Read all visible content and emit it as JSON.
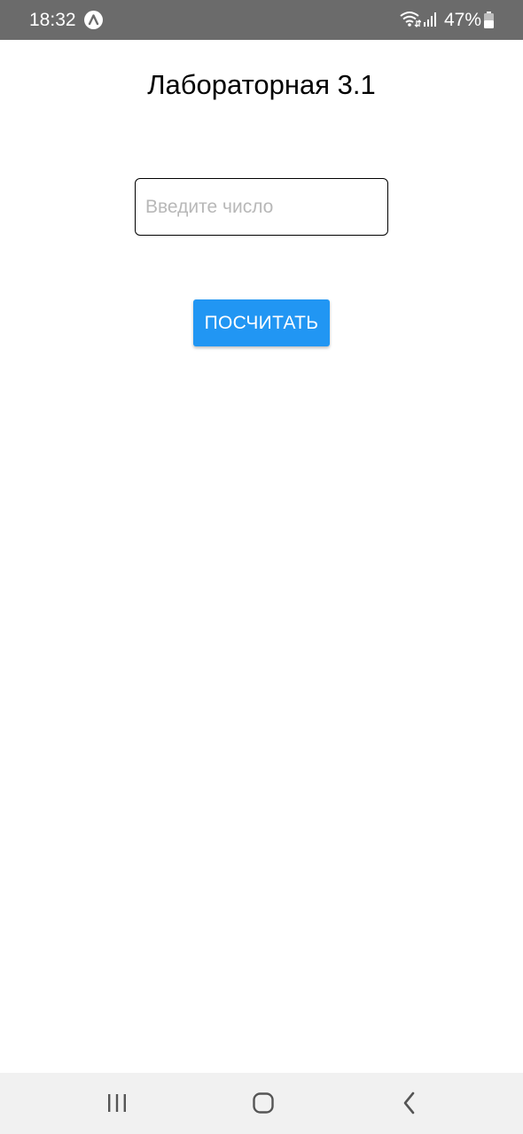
{
  "status_bar": {
    "time": "18:32",
    "app_badge_icon": "a-launcher-icon",
    "wifi_icon": "wifi-icon",
    "signal_icon": "signal-icon",
    "battery_percent": "47%",
    "battery_icon": "battery-icon",
    "background_color": "#6b6b6b"
  },
  "main": {
    "title": "Лабораторная 3.1",
    "number_input": {
      "value": "",
      "placeholder": "Введите число"
    },
    "calculate_button": {
      "label": "ПОСЧИТАТЬ",
      "color": "#2196f3"
    }
  },
  "nav_bar": {
    "recents_icon": "recents-icon",
    "home_icon": "home-icon",
    "back_icon": "back-icon"
  }
}
